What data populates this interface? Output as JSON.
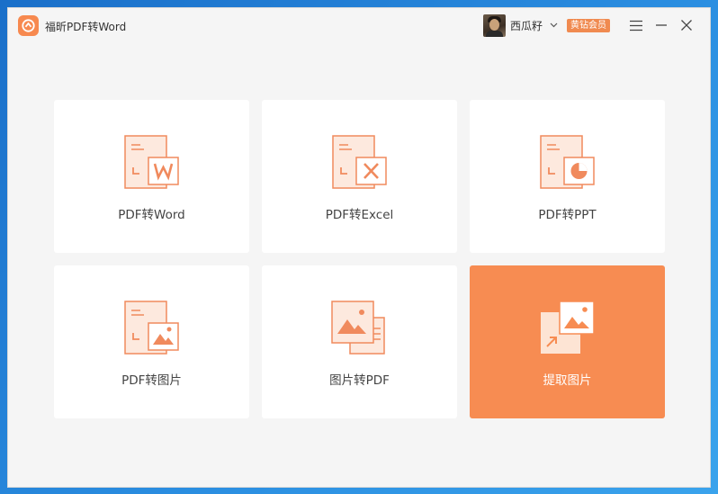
{
  "app": {
    "title": "福昕PDF转Word",
    "logo_icon": "app-logo-icon"
  },
  "user": {
    "name": "西瓜籽",
    "badge": "黄钻会员",
    "avatar_icon": "avatar"
  },
  "window_controls": {
    "menu_icon": "hamburger-menu-icon",
    "minimize_icon": "minimize-icon",
    "close_icon": "close-icon"
  },
  "tools": [
    {
      "label": "PDF转Word",
      "icon": "pdf-to-word-icon"
    },
    {
      "label": "PDF转Excel",
      "icon": "pdf-to-excel-icon"
    },
    {
      "label": "PDF转PPT",
      "icon": "pdf-to-ppt-icon"
    },
    {
      "label": "PDF转图片",
      "icon": "pdf-to-image-icon"
    },
    {
      "label": "图片转PDF",
      "icon": "image-to-pdf-icon"
    },
    {
      "label": "提取图片",
      "icon": "extract-image-icon"
    }
  ],
  "colors": {
    "accent": "#f78c52",
    "icon_stroke": "#f08a5d",
    "icon_fill": "#fde9de",
    "window_bg": "#f5f5f5",
    "card_bg": "#ffffff"
  },
  "selected_tool_index": 5
}
